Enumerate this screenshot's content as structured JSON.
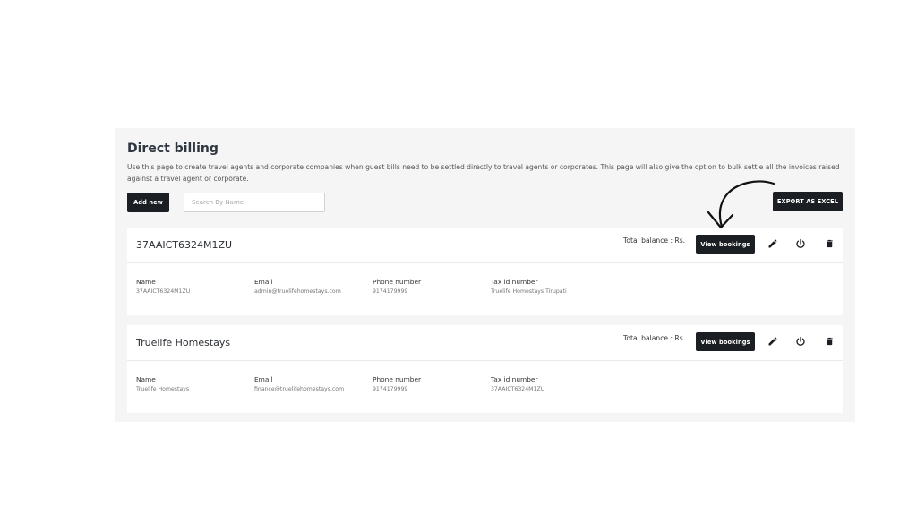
{
  "header": {
    "title": "Direct billing",
    "description": "Use this page to create travel agents and corporate companies when guest bills need to be settled directly to travel agents or corporates. This page will also give the option to bulk settle all the invoices raised against a travel agent or corporate."
  },
  "toolbar": {
    "add_new_label": "Add new",
    "search_placeholder": "Search By Name",
    "search_value": "",
    "export_label": "EXPORT AS EXCEL"
  },
  "field_labels": {
    "name": "Name",
    "email": "Email",
    "phone": "Phone number",
    "tax": "Tax id number"
  },
  "accounts": [
    {
      "title": "37AAICT6324M1ZU",
      "balance_label": "Total balance : Rs.",
      "view_label": "View bookings",
      "name": "37AAICT6324M1ZU",
      "email": "admin@truelifehomestays.com",
      "phone": "9174179999",
      "tax": "Truelife Homestays Tirupati"
    },
    {
      "title": "Truelife Homestays",
      "balance_label": "Total balance : Rs.",
      "view_label": "View bookings",
      "name": "Truelife Homestays",
      "email": "finance@truelifehomestays.com",
      "phone": "9174179999",
      "tax": "37AAICT6324M1ZU"
    }
  ],
  "icons": {
    "edit": "pencil-icon",
    "power": "power-icon",
    "delete": "trash-icon",
    "annotation": "hand-drawn-arrow"
  },
  "colors": {
    "button_dark": "#1b1e22",
    "panel_bg": "#f5f5f6"
  }
}
